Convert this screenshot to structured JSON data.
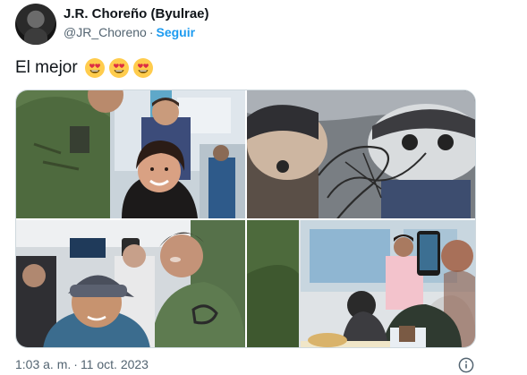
{
  "author": {
    "display_name": "J.R. Choreño (Byulrae)",
    "handle": "@JR_Choreno",
    "separator": "·",
    "follow_label": "Seguir"
  },
  "tweet": {
    "text": "El mejor",
    "emojis": [
      "smiling-face-with-heart-eyes",
      "smiling-face-with-heart-eyes",
      "smiling-face-with-heart-eyes"
    ]
  },
  "media": {
    "count": 4,
    "photos": [
      {
        "name": "photo-selfie-fans-airport"
      },
      {
        "name": "photo-signed-funko-box"
      },
      {
        "name": "photo-selfie-fan-cap"
      },
      {
        "name": "photo-autograph-signing"
      }
    ]
  },
  "footer": {
    "time": "1:03 a. m.",
    "separator": "·",
    "date": "11 oct. 2023",
    "info_icon": "info-circle-icon"
  },
  "colors": {
    "accent": "#1d9bf0",
    "text_primary": "#0f1419",
    "text_secondary": "#536471",
    "border": "#cfd9de"
  }
}
